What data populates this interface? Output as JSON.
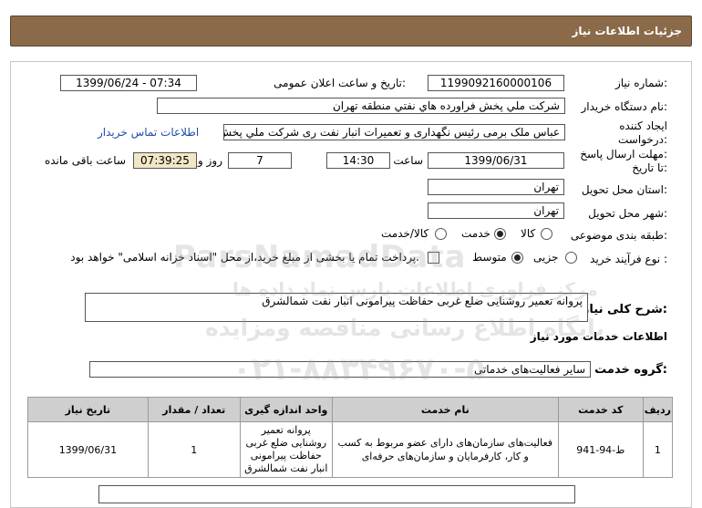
{
  "header": {
    "title": "جزئیات اطلاعات نیاز"
  },
  "form": {
    "need_number_label": "شماره نیاز:",
    "need_number": "1199092160000106",
    "announce_label": "تاریخ و ساعت اعلان عمومی:",
    "announce_value": "1399/06/24 - 07:34",
    "buyer_label": "نام دستگاه خریدار:",
    "buyer_value": "شرکت ملي پخش فراورده هاي نفتي منطقه تهران",
    "creator_label_1": "ایجاد کننده",
    "creator_label_2": "درخواست:",
    "creator_value": "عباس ملک برمی رئیس نگهداری و تعمیرات انبار نفت ری شرکت ملي پخش فراور",
    "contact_link": "اطلاعات تماس خریدار",
    "deadline_label_1": "مهلت ارسال پاسخ:",
    "deadline_label_2": "تا تاریخ:",
    "deadline_date": "1399/06/31",
    "time_label": "ساعت",
    "deadline_time": "14:30",
    "days_value": "7",
    "days_label": "روز و",
    "remaining_time": "07:39:25",
    "remaining_label": "ساعت باقی مانده",
    "province_label": "استان محل تحویل:",
    "province_value": "تهران",
    "city_label": "شهر محل تحویل:",
    "city_value": "تهران",
    "category_label": "طبقه بندی موضوعی:",
    "category_options": [
      "کالا",
      "خدمت",
      "کالا/خدمت"
    ],
    "category_selected": "خدمت",
    "process_label": "نوع فرآیند خرید :",
    "process_options": [
      "جزیی",
      "متوسط"
    ],
    "process_selected": "متوسط",
    "payment_note": "پرداخت تمام یا بخشی از مبلغ خرید،از محل \"اسناد خزانه اسلامی\" خواهد بود.",
    "description_label": "شرح کلی نیاز:",
    "description_value": "پروانه تعمیر روشنایی ضلع غربی حفاظت پیرامونی انبار نفت شمالشرق",
    "services_title": "اطلاعات خدمات مورد نیاز",
    "service_group_label": "گروه خدمت:",
    "service_group_value": "سایر فعالیت‌های خدماتی"
  },
  "table": {
    "headers": [
      "ردیف",
      "کد خدمت",
      "نام خدمت",
      "واحد اندازه گیری",
      "تعداد / مقدار",
      "تاریخ نیاز"
    ],
    "rows": [
      {
        "row": "1",
        "code": "ط-94-941",
        "name": "فعالیت‌های سازمان‌های دارای عضو مربوط به کسب و کار، کارفرمایان و سازمان‌های حرفه‌ای",
        "unit": "پروانه تعمیر روشنایی ضلع غربی حفاظت پیرامونی انبار نفت شمالشرق",
        "qty": "1",
        "date": "1399/06/31"
      }
    ]
  },
  "watermark": {
    "line1": "ParsNamadData",
    "line2": "مرکز فراوری اطلاعات پارس نماد داده ها",
    "line3": "پایگاه اطلاع رسانی مناقصه ومزایده",
    "line4": "۰۲۱-۸۸۳۴۹۶۷۰-۵"
  }
}
